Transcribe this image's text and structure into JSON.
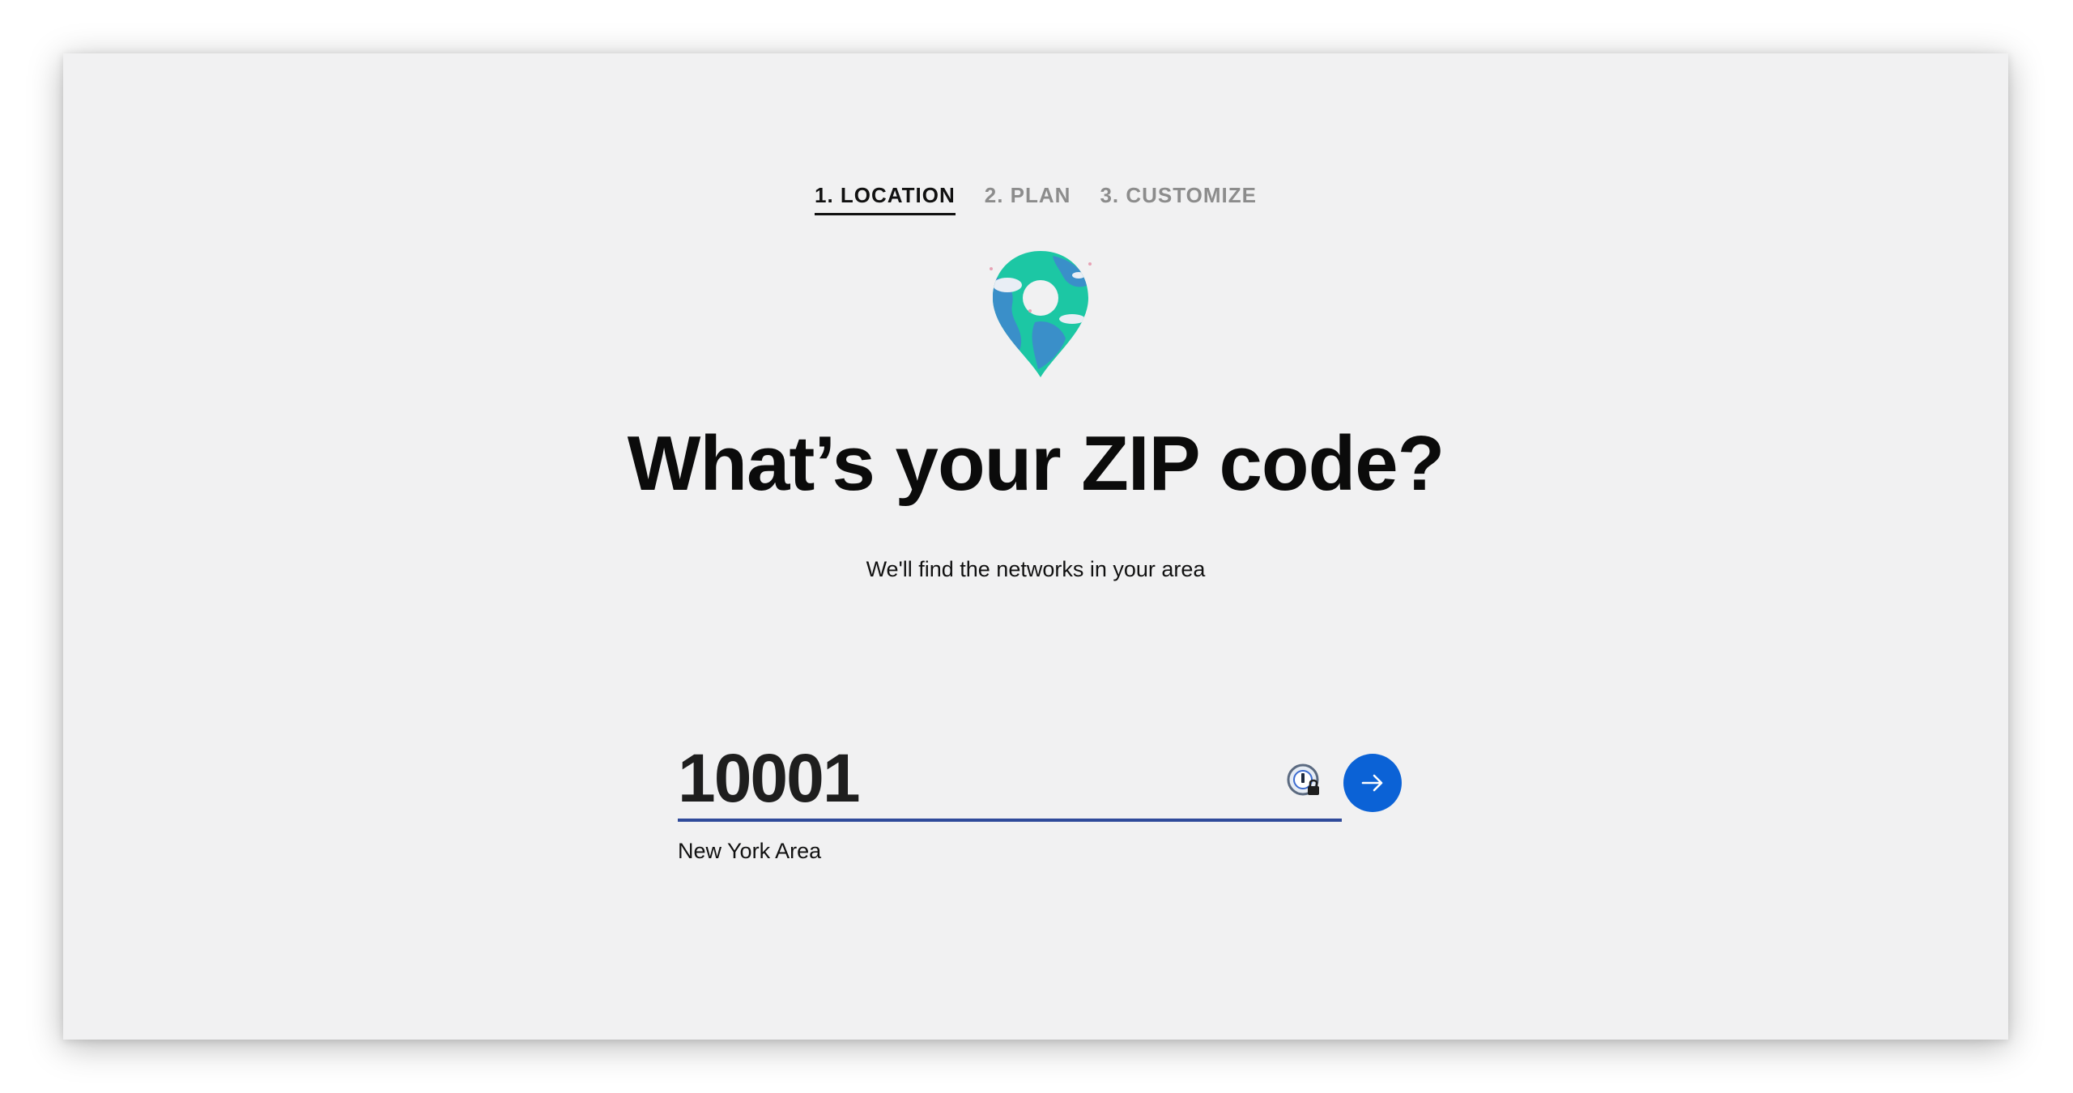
{
  "steps": [
    {
      "label": "1. LOCATION",
      "active": true
    },
    {
      "label": "2. PLAN",
      "active": false
    },
    {
      "label": "3. CUSTOMIZE",
      "active": false
    }
  ],
  "hero": {
    "icon": "location-pin-globe-icon",
    "title": "What’s your ZIP code?",
    "subtitle": "We'll find the networks in your area"
  },
  "zip": {
    "value": "10001",
    "area": "New York Area",
    "password_manager_icon": "password-manager-lock-icon",
    "submit_icon": "arrow-right-icon"
  },
  "colors": {
    "background": "#f1f1f2",
    "accent": "#0b62d6",
    "underline": "#2f4a9a",
    "pin_teal": "#1cc7a4",
    "pin_blue": "#3a8fc9"
  }
}
